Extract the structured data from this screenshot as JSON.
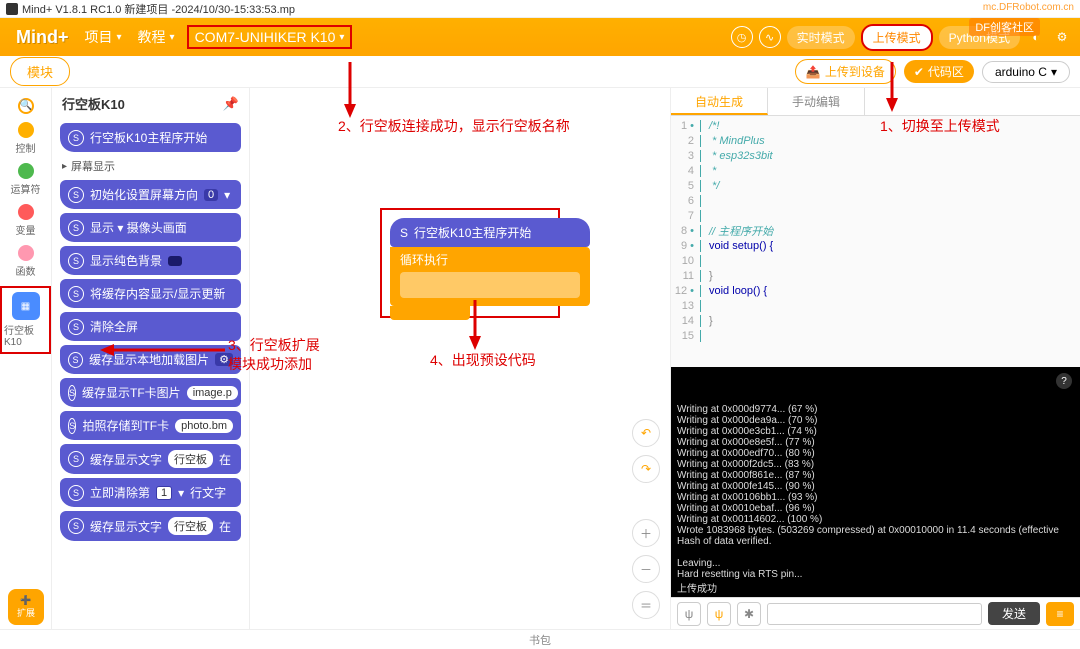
{
  "window": {
    "title": "Mind+ V1.8.1 RC1.0  新建项目 -2024/10/30-15:33:53.mp"
  },
  "watermark": {
    "text": "mc.DFRobot.com.cn",
    "logo": "DF创客社区"
  },
  "toolbar": {
    "logo": "Mind+",
    "menu_project": "项目",
    "menu_tutorial": "教程",
    "connection": "COM7-UNIHIKER K10",
    "realtime": "实时模式",
    "upload": "上传模式",
    "python": "Python模式"
  },
  "subbar": {
    "tab_blocks": "模块",
    "upload_device": "上传到设备",
    "code_area": "代码区",
    "lang": "arduino C"
  },
  "categories": {
    "search": "",
    "control": "控制",
    "operators": "运算符",
    "variables": "变量",
    "functions": "函数",
    "k10": "行空板K10"
  },
  "palette": {
    "title": "行空板K10",
    "section_screen": "屏幕显示",
    "blocks": [
      "行空板K10主程序开始",
      "初始化设置屏幕方向",
      "显示 ▾  摄像头画面",
      "显示纯色背景",
      "将缓存内容显示/显示更新",
      "清除全屏",
      "缓存显示本地加载图片",
      "缓存显示TF卡图片",
      "拍照存储到TF卡",
      "缓存显示文字",
      "立即清除第",
      "缓存显示文字"
    ],
    "inline": {
      "dir_val": "0",
      "img_param": "image.p",
      "photo_param": "photo.bm",
      "text_param": "行空板",
      "at": "在",
      "line_num": "1",
      "line_txt": "行文字"
    }
  },
  "annotations": {
    "a1": "1、切换至上传模式",
    "a2": "2、行空板连接成功，显示行空板名称",
    "a3_l1": "3、行空板扩展",
    "a3_l2": "模块成功添加",
    "a4": "4、出现预设代码"
  },
  "canvas_block": {
    "hat": "行空板K10主程序开始",
    "body": "循环执行"
  },
  "codeTabs": {
    "auto": "自动生成",
    "manual": "手动编辑"
  },
  "code": {
    "lines": [
      {
        "n": "1",
        "dot": true,
        "text": "/*!",
        "cls": "cm"
      },
      {
        "n": "2",
        "text": " * MindPlus",
        "cls": "cm"
      },
      {
        "n": "3",
        "text": " * esp32s3bit",
        "cls": "cm"
      },
      {
        "n": "4",
        "text": " *",
        "cls": "cm"
      },
      {
        "n": "5",
        "text": " */",
        "cls": "cm"
      },
      {
        "n": "6",
        "text": "",
        "cls": ""
      },
      {
        "n": "7",
        "text": "",
        "cls": ""
      },
      {
        "n": "8",
        "dot": true,
        "text": "// 主程序开始",
        "cls": "cm"
      },
      {
        "n": "9",
        "dot": true,
        "text": "void setup() {",
        "cls": "kw"
      },
      {
        "n": "10",
        "text": "",
        "cls": ""
      },
      {
        "n": "11",
        "text": "}",
        "cls": ""
      },
      {
        "n": "12",
        "dot": true,
        "text": "void loop() {",
        "cls": "kw"
      },
      {
        "n": "13",
        "text": "",
        "cls": ""
      },
      {
        "n": "14",
        "text": "}",
        "cls": ""
      },
      {
        "n": "15",
        "text": "",
        "cls": ""
      }
    ]
  },
  "console": {
    "lines": [
      "Writing at 0x000d9774... (67 %)",
      "Writing at 0x000dea9a... (70 %)",
      "Writing at 0x000e3cb1... (74 %)",
      "Writing at 0x000e8e5f... (77 %)",
      "Writing at 0x000edf70... (80 %)",
      "Writing at 0x000f2dc5... (83 %)",
      "Writing at 0x000f861e... (87 %)",
      "Writing at 0x000fe145... (90 %)",
      "Writing at 0x00106bb1... (93 %)",
      "Writing at 0x0010ebaf... (96 %)",
      "Writing at 0x00114602... (100 %)",
      "Wrote 1083968 bytes. (503269 compressed) at 0x00010000 in 11.4 seconds (effective",
      "Hash of data verified.",
      "",
      "Leaving...",
      "Hard resetting via RTS pin...",
      "上传成功"
    ]
  },
  "sendbar": {
    "send": "发送"
  },
  "footer": {
    "backpack": "书包"
  },
  "ext_btn": "扩展"
}
